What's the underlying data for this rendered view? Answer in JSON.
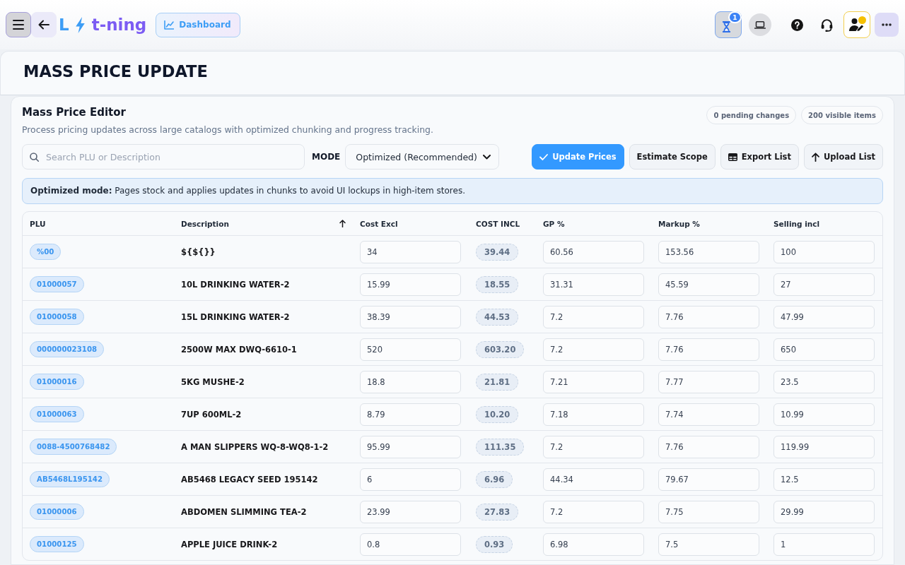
{
  "topbar": {
    "logo": {
      "initial": "L",
      "word": "t-ning"
    },
    "dashboard_label": "Dashboard",
    "notification_count": "1"
  },
  "page_title": "MASS PRICE UPDATE",
  "editor": {
    "title": "Mass Price Editor",
    "subtitle": "Process pricing updates across large catalogs with optimized chunking and progress tracking.",
    "counts": [
      "0 pending changes",
      "200 visible items"
    ],
    "search": {
      "placeholder": "Search PLU or Description"
    },
    "mode": {
      "label": "MODE",
      "value": "Optimized (Recommended)"
    },
    "actions": [
      {
        "label": "Update Prices",
        "kind": "primary"
      },
      {
        "label": "Estimate Scope",
        "kind": "plain"
      },
      {
        "label": "Export List",
        "kind": "export"
      },
      {
        "label": "Upload List",
        "kind": "upload"
      }
    ],
    "notice": "**Optimized mode:** Pages stock and applies updates in chunks to avoid UI lockups in high-item stores.",
    "table": {
      "columns": [
        {
          "label": "PLU",
          "sorted": false
        },
        {
          "label": "Description",
          "sorted": true
        },
        {
          "label": "Cost Excl",
          "sorted": false
        },
        {
          "label": "COST INCL",
          "sorted": false
        },
        {
          "label": "GP %",
          "sorted": false
        },
        {
          "label": "Markup %",
          "sorted": false
        },
        {
          "label": "Selling incl",
          "sorted": false
        }
      ],
      "rows": [
        {
          "plu": "%00",
          "description": "${${}}",
          "cost_excl": "34",
          "cost_incl": "39.44",
          "gp_percent": "60.56",
          "markup_percent": "153.56",
          "selling_incl": "100"
        },
        {
          "plu": "01000057",
          "description": "10L DRINKING WATER-2",
          "cost_excl": "15.99",
          "cost_incl": "18.55",
          "gp_percent": "31.31",
          "markup_percent": "45.59",
          "selling_incl": "27"
        },
        {
          "plu": "01000058",
          "description": "15L DRINKING WATER-2",
          "cost_excl": "38.39",
          "cost_incl": "44.53",
          "gp_percent": "7.2",
          "markup_percent": "7.76",
          "selling_incl": "47.99"
        },
        {
          "plu": "000000023108",
          "description": "2500W MAX DWQ-6610-1",
          "cost_excl": "520",
          "cost_incl": "603.20",
          "gp_percent": "7.2",
          "markup_percent": "7.76",
          "selling_incl": "650"
        },
        {
          "plu": "01000016",
          "description": "5KG MUSHE-2",
          "cost_excl": "18.8",
          "cost_incl": "21.81",
          "gp_percent": "7.21",
          "markup_percent": "7.77",
          "selling_incl": "23.5"
        },
        {
          "plu": "01000063",
          "description": "7UP 600ML-2",
          "cost_excl": "8.79",
          "cost_incl": "10.20",
          "gp_percent": "7.18",
          "markup_percent": "7.74",
          "selling_incl": "10.99"
        },
        {
          "plu": "0088-4500768482",
          "description": "A MAN SLIPPERS WQ-8-WQ8-1-2",
          "cost_excl": "95.99",
          "cost_incl": "111.35",
          "gp_percent": "7.2",
          "markup_percent": "7.76",
          "selling_incl": "119.99"
        },
        {
          "plu": "AB5468L195142",
          "description": "AB5468 LEGACY SEED 195142",
          "cost_excl": "6",
          "cost_incl": "6.96",
          "gp_percent": "44.34",
          "markup_percent": "79.67",
          "selling_incl": "12.5"
        },
        {
          "plu": "01000006",
          "description": "ABDOMEN SLIMMING TEA-2",
          "cost_excl": "23.99",
          "cost_incl": "27.83",
          "gp_percent": "7.2",
          "markup_percent": "7.75",
          "selling_incl": "29.99"
        },
        {
          "plu": "01000125",
          "description": "APPLE JUICE DRINK-2",
          "cost_excl": "0.8",
          "cost_incl": "0.93",
          "gp_percent": "6.98",
          "markup_percent": "7.5",
          "selling_incl": "1"
        }
      ]
    }
  }
}
